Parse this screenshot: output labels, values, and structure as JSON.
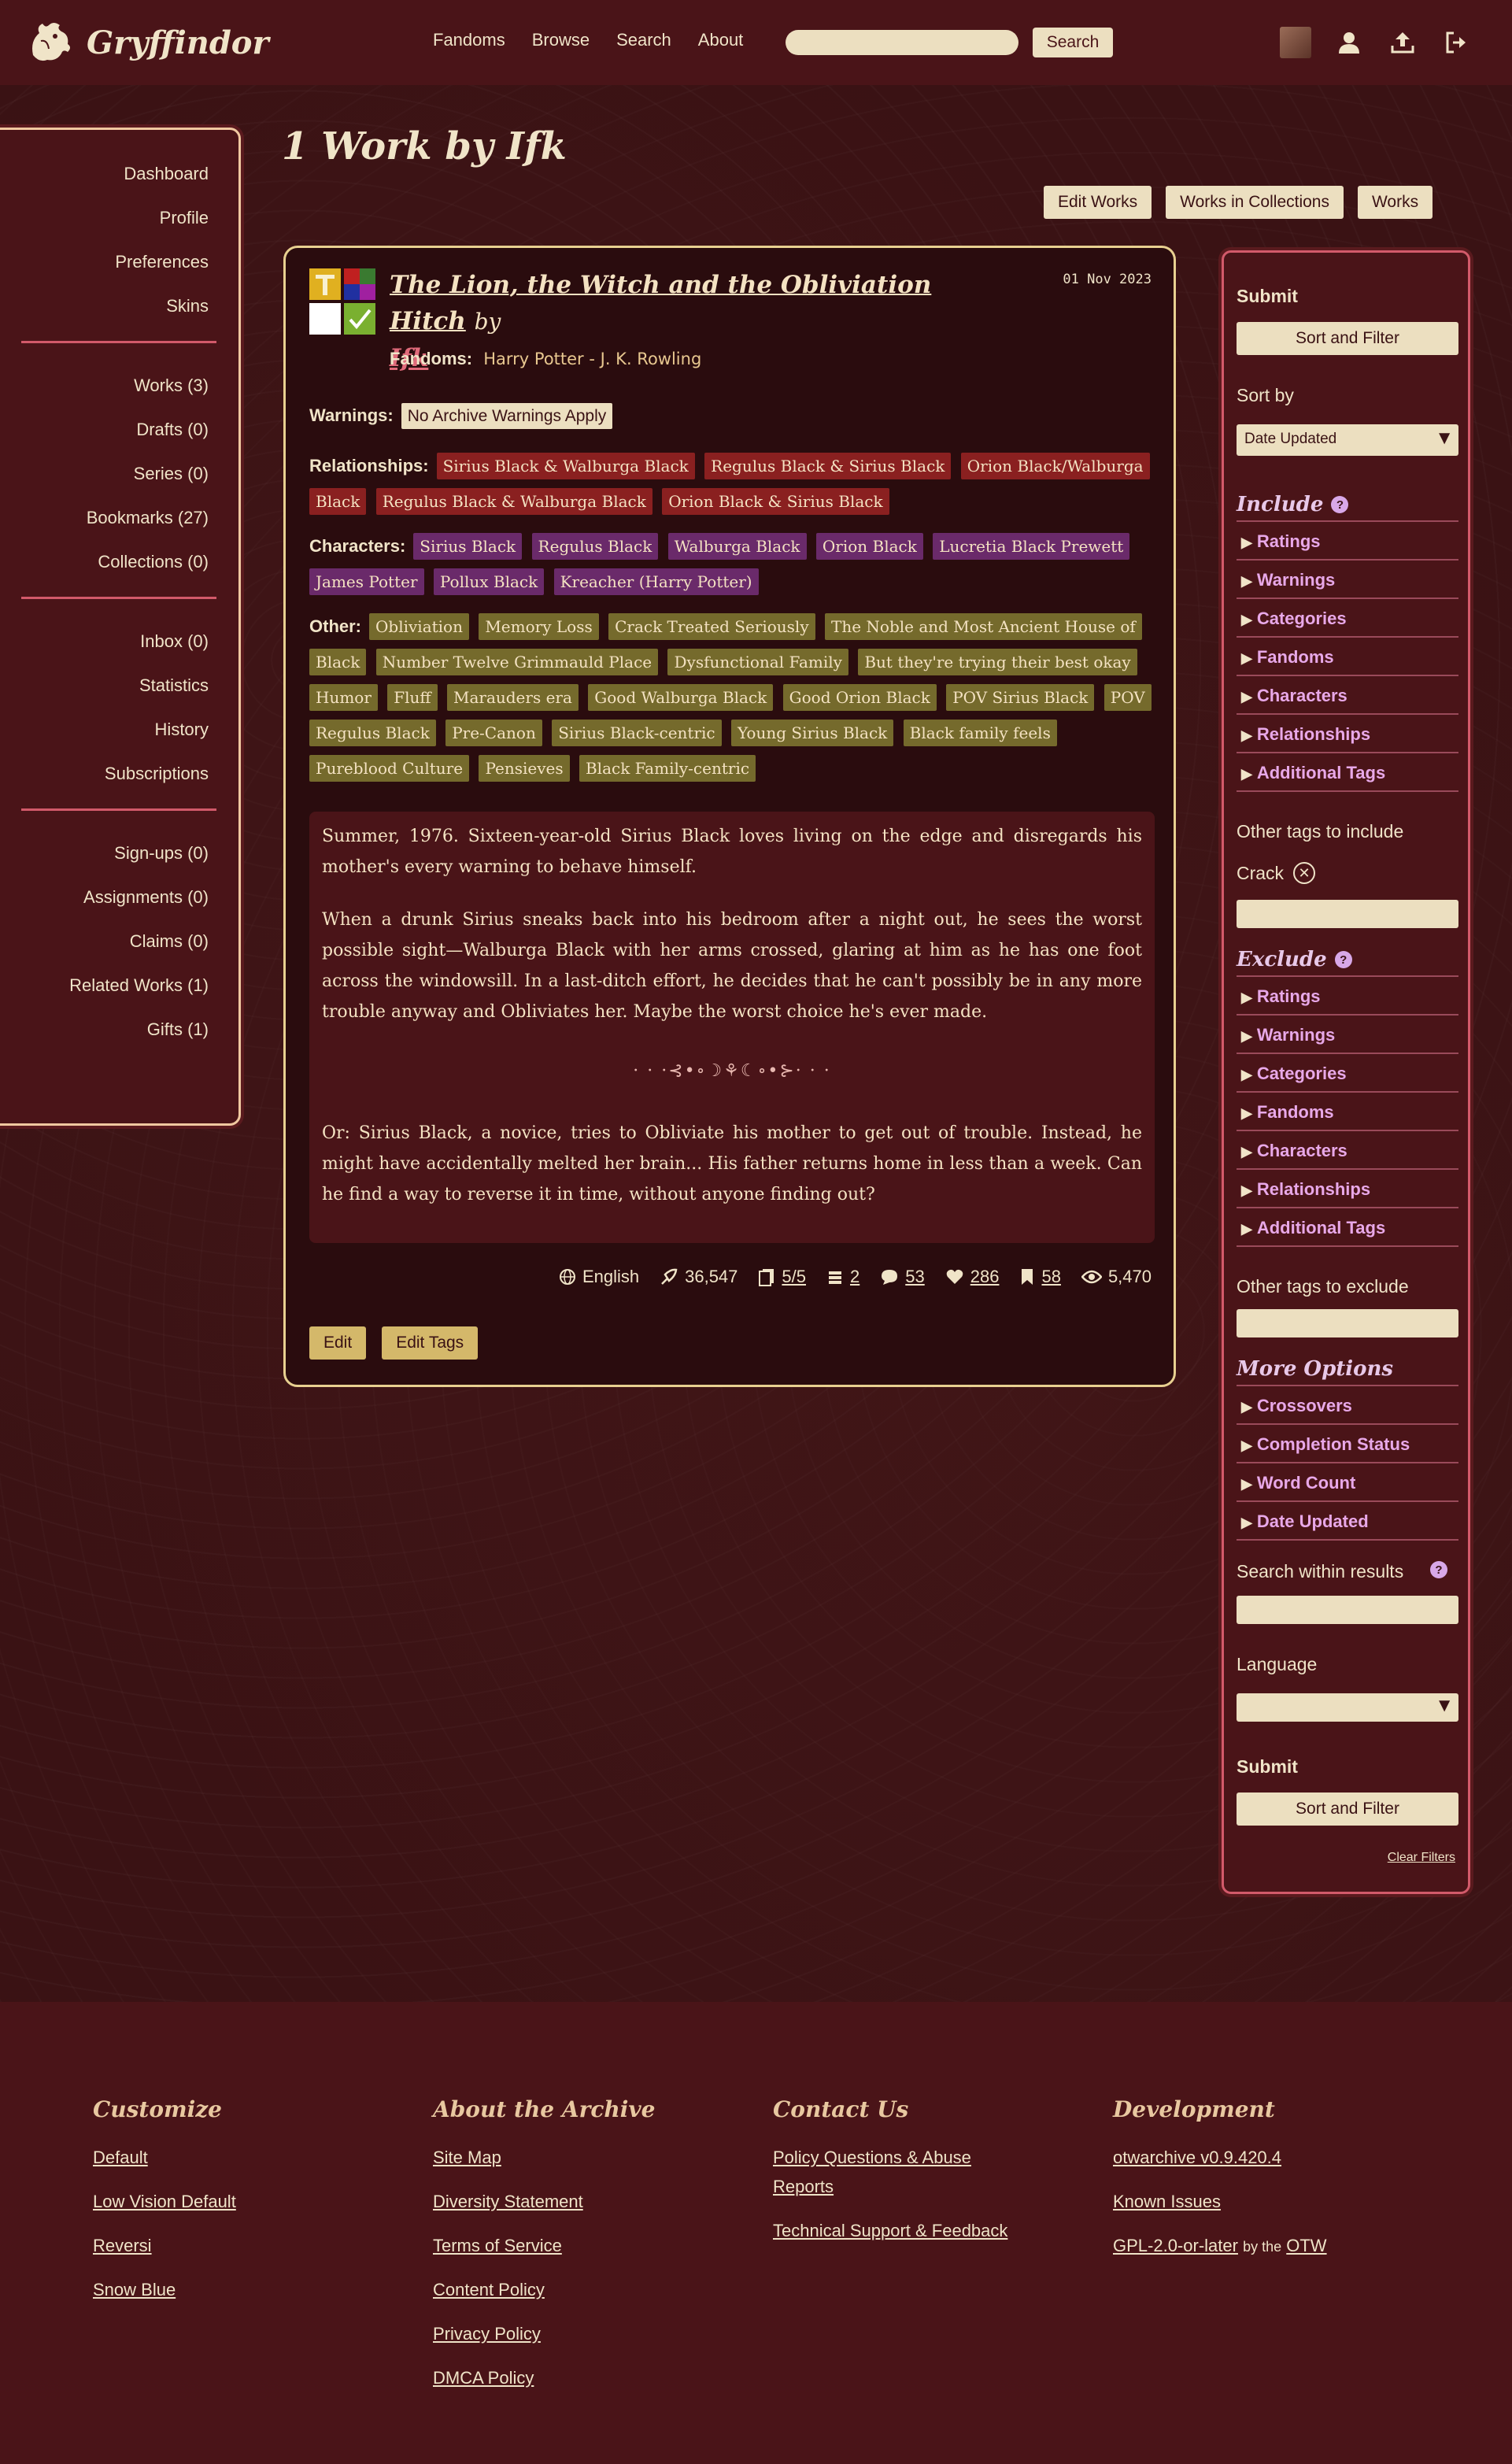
{
  "colors": {
    "bg": "#3a1214",
    "header": "#4a1418",
    "cream": "#ecdfc0",
    "relationship_tag": "#8a2020",
    "character_tag": "#6a2a6a",
    "freeform_tag": "#756a2c",
    "accent_pink": "#e8a8e8"
  },
  "header": {
    "site_name": "Gryffindor",
    "nav": [
      "Fandoms",
      "Browse",
      "Search",
      "About"
    ],
    "search_button": "Search",
    "icons": [
      "avatar",
      "user-icon",
      "upload-icon",
      "logout-icon"
    ]
  },
  "dashboard": {
    "group1": [
      "Dashboard",
      "Profile",
      "Preferences",
      "Skins"
    ],
    "group2": [
      "Works (3)",
      "Drafts (0)",
      "Series (0)",
      "Bookmarks (27)",
      "Collections (0)"
    ],
    "group3": [
      "Inbox (0)",
      "Statistics",
      "History",
      "Subscriptions"
    ],
    "group4": [
      "Sign-ups (0)",
      "Assignments (0)",
      "Claims (0)",
      "Related Works (1)",
      "Gifts (1)"
    ]
  },
  "main": {
    "title": "1 Work by Ifk",
    "nav_buttons": [
      "Edit Works",
      "Works in Collections",
      "Works"
    ]
  },
  "work": {
    "title": "The Lion, the Witch and the Obliviation Hitch",
    "by": "by",
    "author": "Ifk",
    "date": "01 Nov 2023",
    "fandoms_label": "Fandoms:",
    "fandom": "Harry Potter - J. K. Rowling",
    "warnings_label": "Warnings:",
    "warnings": [
      "No Archive Warnings Apply"
    ],
    "relationships_label": "Relationships:",
    "relationships": [
      "Sirius Black & Walburga Black",
      "Regulus Black & Sirius Black",
      "Orion Black/Walburga Black",
      "Regulus Black & Walburga Black",
      "Orion Black & Sirius Black"
    ],
    "characters_label": "Characters:",
    "characters": [
      "Sirius Black",
      "Regulus Black",
      "Walburga Black",
      "Orion Black",
      "Lucretia Black Prewett",
      "James Potter",
      "Pollux Black",
      "Kreacher (Harry Potter)"
    ],
    "other_label": "Other:",
    "freeforms": [
      "Obliviation",
      "Memory Loss",
      "Crack Treated Seriously",
      "The Noble and Most Ancient House of Black",
      "Number Twelve Grimmauld Place",
      "Dysfunctional Family",
      "But they're trying their best okay",
      "Humor",
      "Fluff",
      "Marauders era",
      "Good Walburga Black",
      "Good Orion Black",
      "POV Sirius Black",
      "POV Regulus Black",
      "Pre-Canon",
      "Sirius Black-centric",
      "Young Sirius Black",
      "Black family feels",
      "Pureblood Culture",
      "Pensieves",
      "Black Family-centric"
    ],
    "summary": [
      "Summer, 1976. Sixteen-year-old Sirius Black loves living on the edge and disregards his mother's every warning to behave himself.",
      "When a drunk Sirius sneaks back into his bedroom after a night out, he sees the worst possible sight—Walburga Black with her arms crossed, glaring at him as he has one foot across the windowsill. In a last-ditch effort, he decides that he can't possibly be in any more trouble anyway and Obliviates her. Maybe the worst choice he's ever made."
    ],
    "ornament": "· · ·⊰•∘☽⚘☾∘•⊱· · ·",
    "summary_tail": "Or: Sirius Black, a novice, tries to Obliviate his mother to get out of trouble. Instead, he might have accidentally melted her brain... His father returns home in less than a week. Can he find a way to reverse it in time, without anyone finding out?",
    "stats": {
      "language": "English",
      "words": "36,547",
      "chapters": "5/5",
      "collections": "2",
      "comments": "53",
      "kudos": "286",
      "bookmarks": "58",
      "hits": "5,470"
    },
    "actions": [
      "Edit",
      "Edit Tags"
    ]
  },
  "filters": {
    "submit_heading": "Submit",
    "sort_filter_button": "Sort and Filter",
    "sort_by_label": "Sort by",
    "sort_by_value": "Date Updated",
    "include_heading": "Include",
    "include_options": [
      "Ratings",
      "Warnings",
      "Categories",
      "Fandoms",
      "Characters",
      "Relationships",
      "Additional Tags"
    ],
    "other_include_label": "Other tags to include",
    "include_chip": "Crack",
    "exclude_heading": "Exclude",
    "exclude_options": [
      "Ratings",
      "Warnings",
      "Categories",
      "Fandoms",
      "Characters",
      "Relationships",
      "Additional Tags"
    ],
    "other_exclude_label": "Other tags to exclude",
    "more_heading": "More Options",
    "more_options": [
      "Crossovers",
      "Completion Status",
      "Word Count",
      "Date Updated"
    ],
    "search_within_label": "Search within results",
    "language_label": "Language",
    "clear_filters": "Clear Filters"
  },
  "footer": {
    "customize": {
      "title": "Customize",
      "links": [
        "Default",
        "Low Vision Default",
        "Reversi",
        "Snow Blue"
      ]
    },
    "about": {
      "title": "About the Archive",
      "links": [
        "Site Map",
        "Diversity Statement",
        "Terms of Service",
        "Content Policy",
        "Privacy Policy",
        "DMCA Policy"
      ]
    },
    "contact": {
      "title": "Contact Us",
      "links": [
        "Policy Questions & Abuse Reports",
        "Technical Support & Feedback"
      ]
    },
    "development": {
      "title": "Development",
      "version": "otwarchive v0.9.420.4",
      "known_issues": "Known Issues",
      "license": "GPL-2.0-or-later",
      "by_the": "by the",
      "otw": "OTW"
    }
  }
}
